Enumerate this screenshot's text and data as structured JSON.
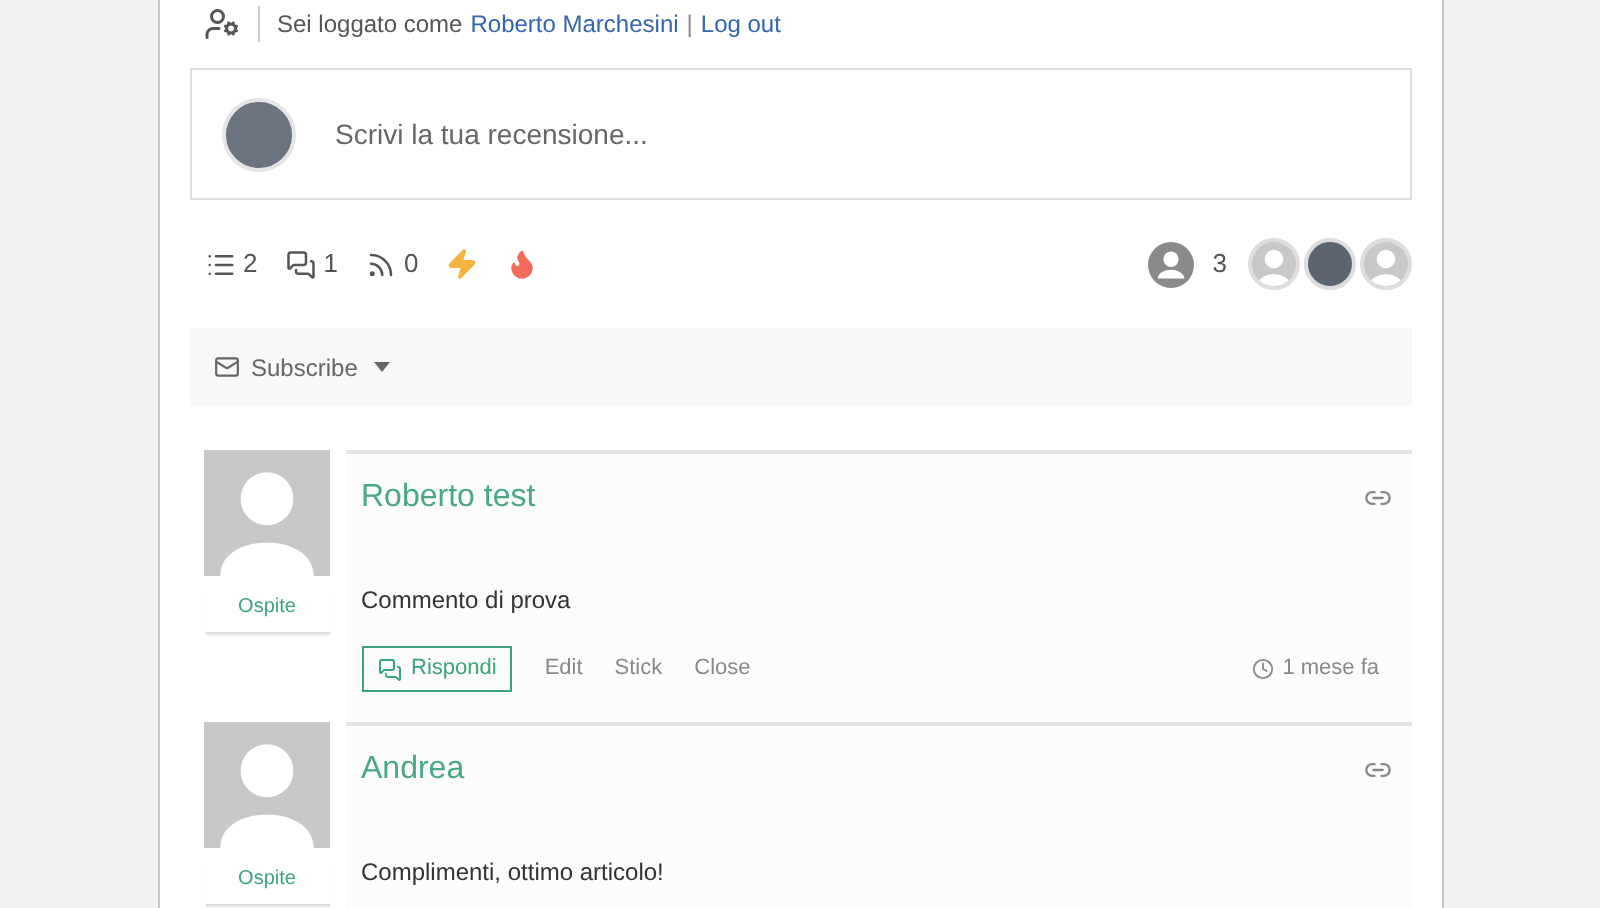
{
  "login_bar": {
    "prefix": "Sei loggato come",
    "user": "Roberto Marchesini",
    "separator": "|",
    "logout": "Log out"
  },
  "review_form": {
    "placeholder": "Scrivi la tua recensione..."
  },
  "stats": [
    {
      "kind": "threads",
      "count": "2"
    },
    {
      "kind": "replies",
      "count": "1"
    },
    {
      "kind": "followers",
      "count": "0"
    },
    {
      "kind": "trending"
    },
    {
      "kind": "hot"
    }
  ],
  "participants": {
    "count": "3",
    "avatars": [
      {
        "kind": "guest"
      },
      {
        "kind": "photo"
      },
      {
        "kind": "guest"
      }
    ]
  },
  "subscribe": {
    "label": "Subscribe"
  },
  "comments": [
    {
      "author": "Roberto test",
      "role": "Ospite",
      "text": "Commento di prova",
      "actions": {
        "reply": "Rispondi",
        "links": [
          "Edit",
          "Stick",
          "Close"
        ],
        "time": "1 mese fa"
      }
    },
    {
      "author": "Andrea",
      "role": "Ospite",
      "text": "Complimenti, ottimo articolo!"
    }
  ]
}
